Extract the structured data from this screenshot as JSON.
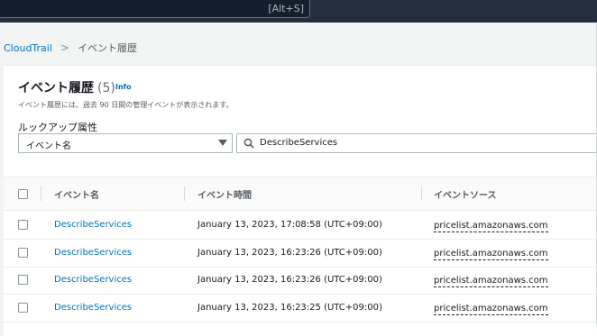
{
  "topbar": {
    "shortcut": "[Alt+S]"
  },
  "breadcrumb": {
    "root": "CloudTrail",
    "separator": ">",
    "current": "イベント履歴"
  },
  "panel": {
    "title": "イベント履歴",
    "count": "(5)",
    "info": "Info",
    "description": "イベント履歴には、過去 90 日間の管理イベントが表示されます。"
  },
  "lookup": {
    "label": "ルックアップ属性",
    "attribute": "イベント名",
    "search_value": "DescribeServices"
  },
  "table": {
    "columns": [
      "イベント名",
      "イベント時間",
      "イベントソース"
    ],
    "rows": [
      {
        "name": "DescribeServices",
        "time": "January 13, 2023, 17:08:58 (UTC+09:00)",
        "source": "pricelist.amazonaws.com"
      },
      {
        "name": "DescribeServices",
        "time": "January 13, 2023, 16:23:26 (UTC+09:00)",
        "source": "pricelist.amazonaws.com"
      },
      {
        "name": "DescribeServices",
        "time": "January 13, 2023, 16:23:26 (UTC+09:00)",
        "source": "pricelist.amazonaws.com"
      },
      {
        "name": "DescribeServices",
        "time": "January 13, 2023, 16:23:25 (UTC+09:00)",
        "source": "pricelist.amazonaws.com"
      }
    ]
  },
  "colors": {
    "nav": "#232f3e",
    "link": "#0073bb",
    "background": "#f2f3f3"
  },
  "icons": {
    "search": "search-icon",
    "dropdown": "caret-down-icon"
  }
}
